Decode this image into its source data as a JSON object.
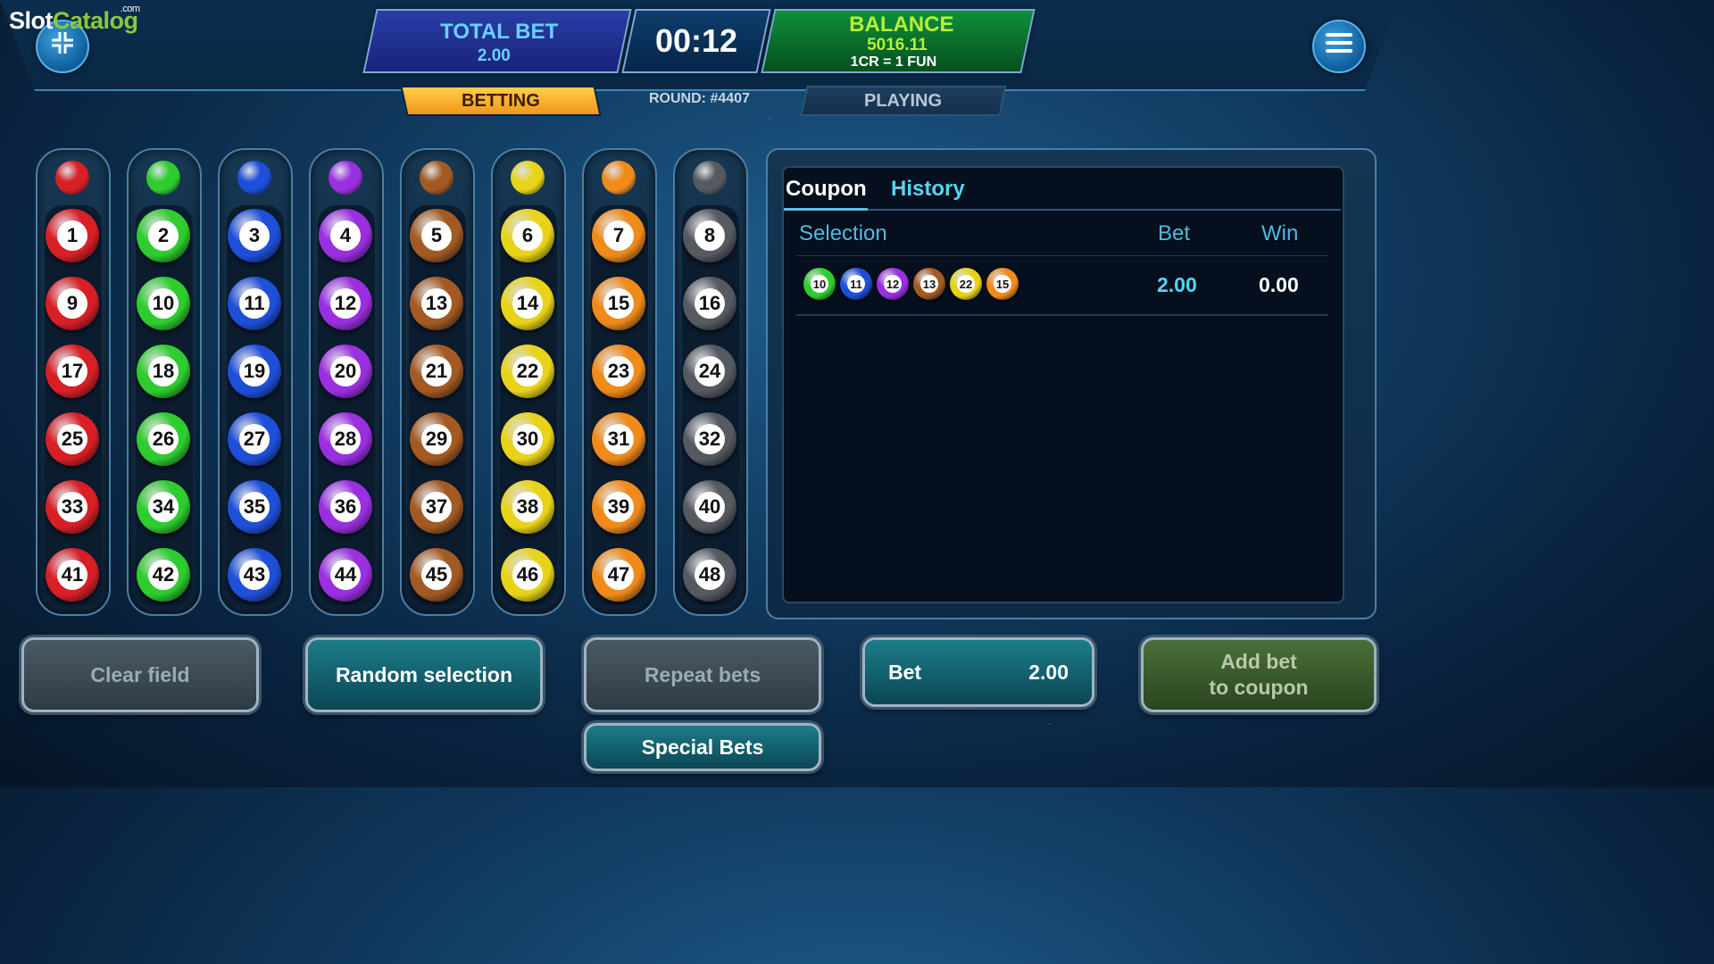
{
  "logo": {
    "part1": "Slot",
    "part2": "Catalog",
    "suffix": ".com"
  },
  "header": {
    "total_bet_label": "TOTAL BET",
    "total_bet_value": "2.00",
    "timer": "00:12",
    "balance_label": "BALANCE",
    "balance_value": "5016.11",
    "rate": "1CR = 1 FUN",
    "minimize_icon": "minimize-icon",
    "menu_icon": "hamburger-menu-icon"
  },
  "tabs": {
    "betting": "BETTING",
    "round": "ROUND: #4407",
    "playing": "PLAYING"
  },
  "colors": {
    "red": "#d81f26",
    "green": "#2ecc2e",
    "blue": "#1e4fd8",
    "purple": "#9a2fe0",
    "brown": "#a35a22",
    "yellow": "#e8d318",
    "orange": "#f08a1a",
    "gray": "#555a60"
  },
  "columns": [
    {
      "color": "red",
      "numbers": [
        "1",
        "9",
        "17",
        "25",
        "33",
        "41"
      ]
    },
    {
      "color": "green",
      "numbers": [
        "2",
        "10",
        "18",
        "26",
        "34",
        "42"
      ]
    },
    {
      "color": "blue",
      "numbers": [
        "3",
        "11",
        "19",
        "27",
        "35",
        "43"
      ]
    },
    {
      "color": "purple",
      "numbers": [
        "4",
        "12",
        "20",
        "28",
        "36",
        "44"
      ]
    },
    {
      "color": "brown",
      "numbers": [
        "5",
        "13",
        "21",
        "29",
        "37",
        "45"
      ]
    },
    {
      "color": "yellow",
      "numbers": [
        "6",
        "14",
        "22",
        "30",
        "38",
        "46"
      ]
    },
    {
      "color": "orange",
      "numbers": [
        "7",
        "15",
        "23",
        "31",
        "39",
        "47"
      ]
    },
    {
      "color": "gray",
      "numbers": [
        "8",
        "16",
        "24",
        "32",
        "40",
        "48"
      ]
    }
  ],
  "coupon": {
    "tab_coupon": "Coupon",
    "tab_history": "History",
    "col_selection": "Selection",
    "col_bet": "Bet",
    "col_win": "Win",
    "rows": [
      {
        "selection": [
          {
            "number": "10",
            "color": "green"
          },
          {
            "number": "11",
            "color": "blue"
          },
          {
            "number": "12",
            "color": "purple"
          },
          {
            "number": "13",
            "color": "brown"
          },
          {
            "number": "22",
            "color": "yellow"
          },
          {
            "number": "15",
            "color": "orange"
          }
        ],
        "bet": "2.00",
        "win": "0.00"
      }
    ]
  },
  "buttons": {
    "clear": "Clear field",
    "random": "Random selection",
    "repeat": "Repeat bets",
    "bet_label": "Bet",
    "bet_value": "2.00",
    "add_line1": "Add bet",
    "add_line2": "to coupon",
    "special": "Special Bets"
  }
}
